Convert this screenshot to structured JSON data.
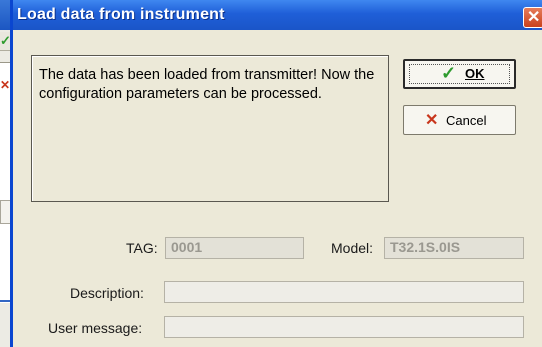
{
  "dialog": {
    "title": "Load data from instrument",
    "message": "The data has been loaded from transmitter! Now the configuration parameters can be processed.",
    "ok_label": "OK",
    "cancel_label": "Cancel",
    "tag_label": "TAG:",
    "tag_value": "0001",
    "model_label": "Model:",
    "model_value": "T32.1S.0IS",
    "description_label": "Description:",
    "description_value": "",
    "user_message_label": "User message:",
    "user_message_value": ""
  },
  "icons": {
    "ok": "check-icon",
    "cancel": "x-icon",
    "close": "close-icon"
  },
  "colors": {
    "titlebar": "#1f5fd8",
    "ok_check": "#2f9b2f",
    "cancel_x": "#c8361c",
    "close_button": "#c9411c"
  }
}
